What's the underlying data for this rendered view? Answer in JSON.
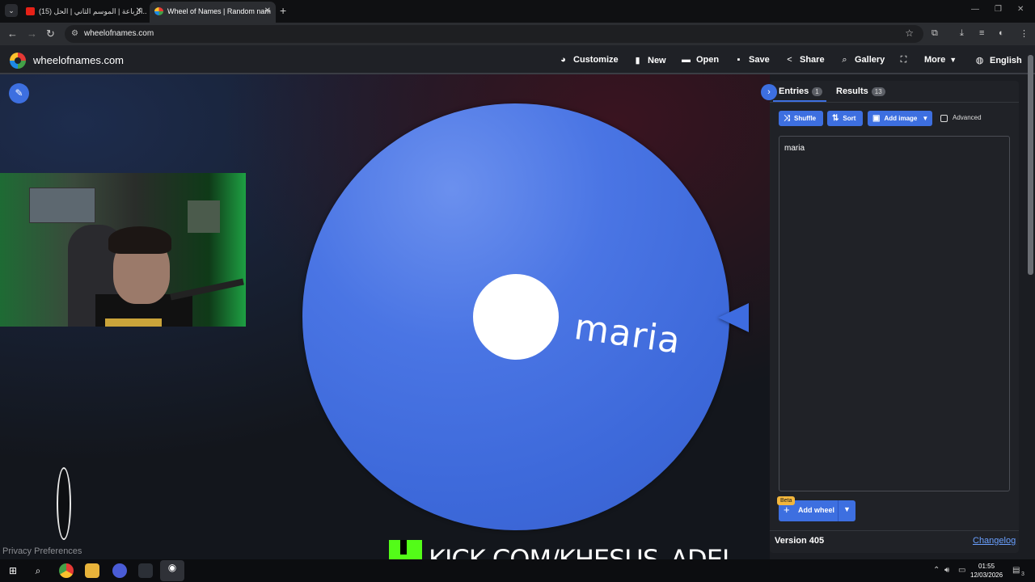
{
  "browser": {
    "tabs": [
      {
        "title": "(15) الرباعة | الموسم الثاني | الحل...",
        "active": false
      },
      {
        "title": "Wheel of Names | Random nam",
        "active": true
      }
    ],
    "url": "wheelofnames.com"
  },
  "app": {
    "logo_text": "wheelofnames.com",
    "menu": {
      "customize": "Customize",
      "new": "New",
      "open": "Open",
      "save": "Save",
      "share": "Share",
      "gallery": "Gallery",
      "more": "More",
      "language": "English"
    }
  },
  "wheel": {
    "segments": [
      "maria"
    ],
    "color": "#3d69da"
  },
  "panel": {
    "tabs": {
      "entries_label": "Entries",
      "entries_count": "1",
      "results_label": "Results",
      "results_count": "13"
    },
    "buttons": {
      "shuffle": "Shuffle",
      "sort": "Sort",
      "add_image": "Add image",
      "advanced": "Advanced"
    },
    "entries_text": "maria",
    "add_wheel": {
      "badge": "Beta",
      "label": "Add wheel"
    },
    "version": "Version 405",
    "changelog": "Changelog"
  },
  "footer": {
    "privacy": "Privacy Preferences"
  },
  "overlay": {
    "kick_text": "KICK.COM/KHESUS_ADEL"
  },
  "taskbar": {
    "time": "01:55",
    "date": "12/03/2026",
    "notifications": "3"
  },
  "colors": {
    "accent": "#3d6fe0",
    "kick_green": "#53fc18"
  }
}
